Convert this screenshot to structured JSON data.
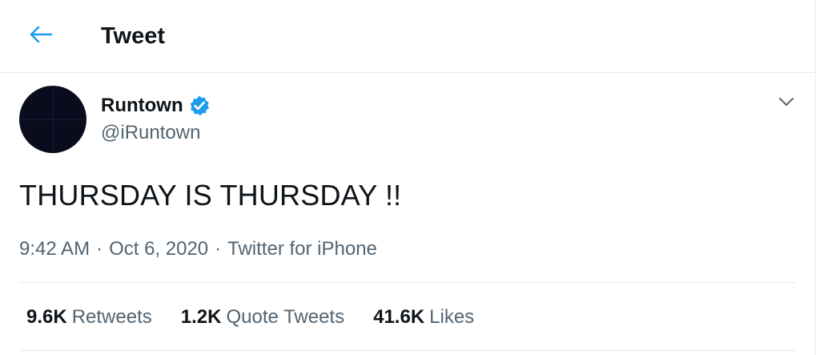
{
  "header": {
    "title": "Tweet",
    "back_icon": "arrow-left-icon",
    "accent_color": "#1d9bf0"
  },
  "tweet": {
    "author": {
      "display_name": "Runtown",
      "handle": "@iRuntown",
      "verified": true,
      "verified_icon": "verified-badge-icon"
    },
    "text": "THURSDAY IS THURSDAY !!",
    "time": "9:42 AM",
    "date": "Oct 6, 2020",
    "separator": "·",
    "source": "Twitter for iPhone",
    "menu_icon": "chevron-down-icon"
  },
  "stats": [
    {
      "count": "9.6K",
      "label": "Retweets"
    },
    {
      "count": "1.2K",
      "label": "Quote Tweets"
    },
    {
      "count": "41.6K",
      "label": "Likes"
    }
  ]
}
